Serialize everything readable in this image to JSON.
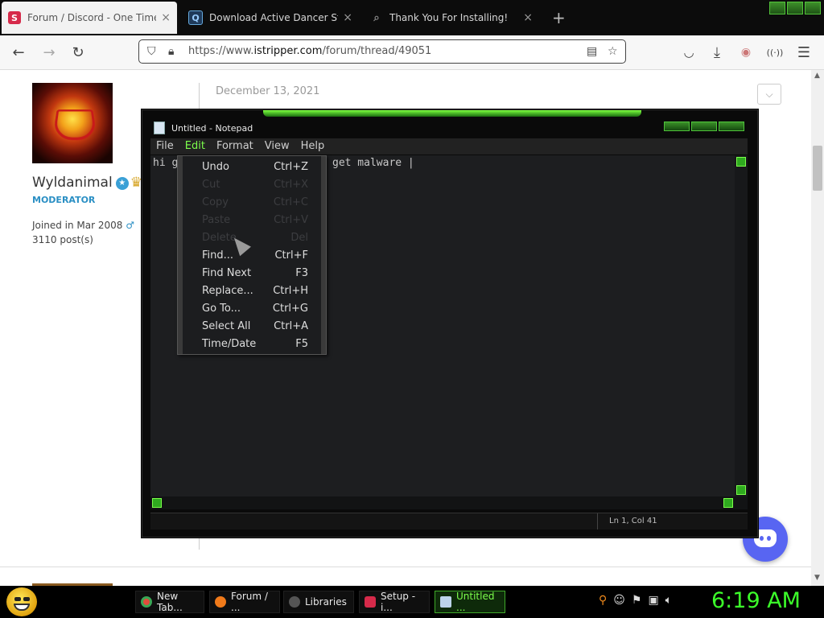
{
  "browser": {
    "tabs": [
      {
        "title": "Forum / Discord - One Time Sh",
        "active": true,
        "close": "×"
      },
      {
        "title": "Download Active Dancer Strip S",
        "active": false,
        "close": "×"
      },
      {
        "title": "Thank You For Installing!",
        "active": false,
        "close": "×"
      }
    ],
    "new_tab": "+",
    "url_prefix": "https://www.",
    "url_domain": "istripper.com",
    "url_path": "/forum/thread/49051"
  },
  "profile": {
    "username": "Wyldanimal",
    "role": "MODERATOR",
    "joined": "Joined in Mar 2008",
    "gender_symbol": "♂",
    "posts": "3110 post(s)"
  },
  "post": {
    "date": "December 13, 2021",
    "dropdown": "⌵"
  },
  "notepad": {
    "title": "Untitled - Notepad",
    "menu": [
      "File",
      "Edit",
      "Format",
      "View",
      "Help"
    ],
    "text_left": "hi g",
    "text_right": "get malware |",
    "status": "Ln 1, Col 41"
  },
  "edit_menu": {
    "items": [
      {
        "label": "Undo",
        "shortcut": "Ctrl+Z",
        "enabled": true
      },
      {
        "label": "Cut",
        "shortcut": "Ctrl+X",
        "enabled": false
      },
      {
        "label": "Copy",
        "shortcut": "Ctrl+C",
        "enabled": false
      },
      {
        "label": "Paste",
        "shortcut": "Ctrl+V",
        "enabled": false
      },
      {
        "label": "Delete",
        "shortcut": "Del",
        "enabled": false
      },
      {
        "label": "Find...",
        "shortcut": "Ctrl+F",
        "enabled": true
      },
      {
        "label": "Find Next",
        "shortcut": "F3",
        "enabled": true
      },
      {
        "label": "Replace...",
        "shortcut": "Ctrl+H",
        "enabled": true
      },
      {
        "label": "Go To...",
        "shortcut": "Ctrl+G",
        "enabled": true
      },
      {
        "label": "Select All",
        "shortcut": "Ctrl+A",
        "enabled": true
      },
      {
        "label": "Time/Date",
        "shortcut": "F5",
        "enabled": true
      }
    ]
  },
  "taskbar": {
    "items": [
      {
        "label": "New Tab...",
        "icon": "chrome-icon",
        "color": "#e24b3b",
        "active": false
      },
      {
        "label": "Forum / ...",
        "icon": "firefox-icon",
        "color": "#f07a1a",
        "active": false
      },
      {
        "label": "Libraries",
        "icon": "libraries-icon",
        "color": "#555555",
        "active": false
      },
      {
        "label": "Setup - i...",
        "icon": "istripper-icon",
        "color": "#d62a4a",
        "active": false
      },
      {
        "label": "Untitled ...",
        "icon": "notepad-icon",
        "color": "#bcd3ea",
        "active": true
      }
    ],
    "clock": "6:19 AM"
  },
  "colors": {
    "accent_green": "#7cff4c",
    "clock_green": "#3cff2a",
    "moderator_blue": "#2a8fc4",
    "discord": "#5865f2"
  }
}
